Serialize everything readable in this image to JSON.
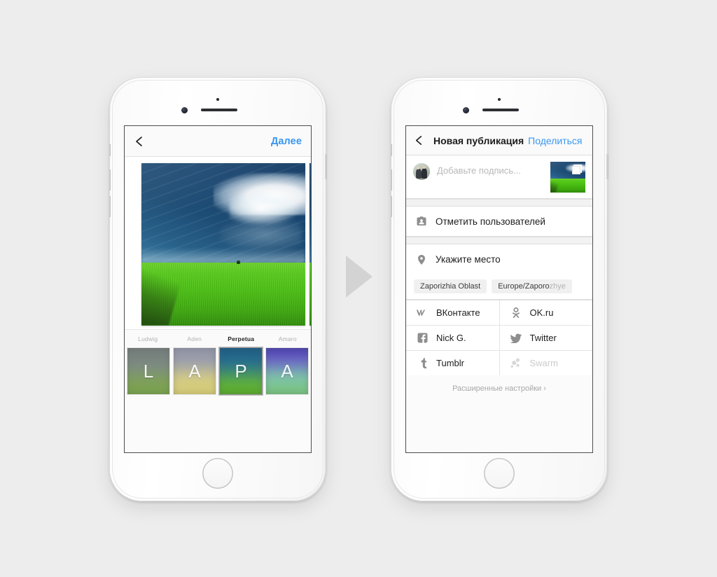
{
  "scene": {
    "background_color": "#ededed",
    "separator_arrow": {
      "icon": "play-triangle-right-icon",
      "color": "#d2d2d2"
    }
  },
  "phone_left": {
    "device": "iphone-white",
    "hardware": {
      "speaker_icon": "earpiece-speaker",
      "camera_icon": "front-camera",
      "sensor_icon": "proximity-sensor",
      "home_button_icon": "home-button"
    },
    "screen": {
      "navbar": {
        "back_icon": "chevron-left-icon",
        "next_label": "Далее",
        "next_color": "#3897f0"
      },
      "photo": {
        "alt": "green wheat field under dark stormy blue sky",
        "has_next_preview": true
      },
      "filters": [
        {
          "name": "Ludwig",
          "letter": "L",
          "selected": false
        },
        {
          "name": "Aden",
          "letter": "A",
          "selected": false
        },
        {
          "name": "Perpetua",
          "letter": "P",
          "selected": true
        },
        {
          "name": "Amaro",
          "letter": "A",
          "selected": false
        }
      ]
    }
  },
  "phone_right": {
    "device": "iphone-white",
    "hardware": {
      "speaker_icon": "earpiece-speaker",
      "camera_icon": "front-camera",
      "sensor_icon": "proximity-sensor",
      "home_button_icon": "home-button"
    },
    "screen": {
      "navbar": {
        "back_icon": "chevron-left-icon",
        "title": "Новая публикация",
        "share_label": "Поделиться",
        "share_color": "#3897f0"
      },
      "caption": {
        "avatar_icon": "user-avatar",
        "placeholder": "Добавьте подпись...",
        "thumbnail_icon": "multiple-photos-icon"
      },
      "rows": [
        {
          "icon": "tag-people-icon",
          "label": "Отметить пользователей"
        },
        {
          "icon": "location-pin-icon",
          "label": "Укажите место"
        }
      ],
      "location_chips": [
        {
          "text": "Zaporizhia Oblast",
          "faded_part": ""
        },
        {
          "text": "Europe/Zaporo",
          "faded_part": "zhye"
        }
      ],
      "social": [
        [
          {
            "icon": "vk-icon",
            "label": "ВКонтакте",
            "enabled": true
          },
          {
            "icon": "ok-ru-icon",
            "label": "OK.ru",
            "enabled": true
          }
        ],
        [
          {
            "icon": "facebook-icon",
            "label": "Nick G.",
            "enabled": true
          },
          {
            "icon": "twitter-icon",
            "label": "Twitter",
            "enabled": true
          }
        ],
        [
          {
            "icon": "tumblr-icon",
            "label": "Tumblr",
            "enabled": true
          },
          {
            "icon": "swarm-icon",
            "label": "Swarm",
            "enabled": false
          }
        ]
      ],
      "advanced": {
        "label": "Расширенные настройки",
        "chevron": "›",
        "icon": "chevron-right-icon"
      }
    }
  }
}
